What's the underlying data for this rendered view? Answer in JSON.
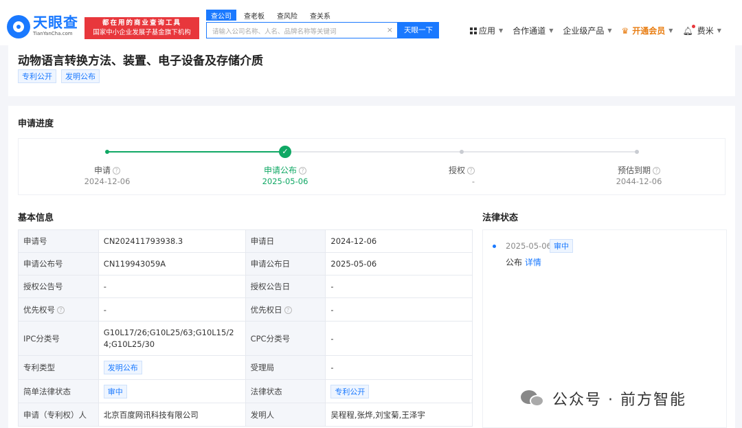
{
  "header": {
    "logo_cn": "天眼查",
    "logo_en": "TianYanCha.com",
    "slogan_line1": "都在用的商业查询工具",
    "slogan_line2": "国家中小企业发展子基金旗下机构",
    "search_tabs": [
      "查公司",
      "查老板",
      "查风险",
      "查关系"
    ],
    "search_placeholder": "请输入公司名称、人名、品牌名称等关键词",
    "search_button": "天眼一下",
    "nav": {
      "apps": "应用",
      "partner": "合作通道",
      "enterprise": "企业级产品",
      "vip": "开通会员",
      "user": "费米"
    }
  },
  "patent": {
    "title": "动物语言转换方法、装置、电子设备及存储介质",
    "tags": [
      "专利公开",
      "发明公布"
    ]
  },
  "progress": {
    "title": "申请进度",
    "steps": [
      {
        "label": "申请",
        "date": "2024-12-06",
        "state": "done"
      },
      {
        "label": "申请公布",
        "date": "2025-05-06",
        "state": "current"
      },
      {
        "label": "授权",
        "date": "-",
        "state": "pending"
      },
      {
        "label": "预估到期",
        "date": "2044-12-06",
        "state": "pending"
      }
    ]
  },
  "basic_info": {
    "title": "基本信息",
    "rows": [
      {
        "k1": "申请号",
        "v1": "CN202411793938.3",
        "k2": "申请日",
        "v2": "2024-12-06"
      },
      {
        "k1": "申请公布号",
        "v1": "CN119943059A",
        "k2": "申请公布日",
        "v2": "2025-05-06"
      },
      {
        "k1": "授权公告号",
        "v1": "-",
        "k2": "授权公告日",
        "v2": "-"
      },
      {
        "k1": "优先权号",
        "v1": "-",
        "k2": "优先权日",
        "v2": "-"
      },
      {
        "k1": "IPC分类号",
        "v1": "G10L17/26;G10L25/63;G10L15/24;G10L25/30",
        "k2": "CPC分类号",
        "v2": "-"
      },
      {
        "k1": "专利类型",
        "v1": "发明公布",
        "k2": "受理局",
        "v2": "-"
      },
      {
        "k1": "简单法律状态",
        "v1": "审中",
        "k2": "法律状态",
        "v2": "专利公开"
      },
      {
        "k1": "申请（专利权）人",
        "v1": "北京百度网讯科技有限公司",
        "k2": "发明人",
        "v2": "吴程程,张烨,刘宝菊,王泽宇"
      }
    ]
  },
  "legal_status": {
    "title": "法律状态",
    "date": "2025-05-06",
    "tag": "审中",
    "event": "公布",
    "detail_link": "详情"
  },
  "watermark": "公众号 · 前方智能",
  "colors": {
    "brand_blue": "#1a79ff",
    "check_green": "#0fa864",
    "slogan_red": "#e8373c",
    "vip_orange": "#e87d12"
  }
}
